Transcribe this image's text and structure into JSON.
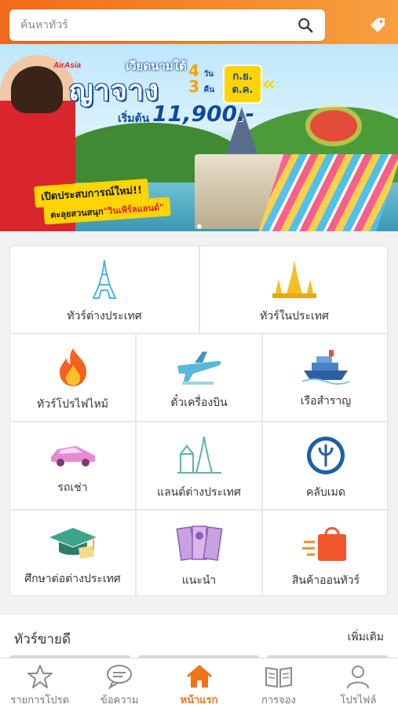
{
  "search": {
    "placeholder": "ค้นหาทัวร์",
    "icon": "search-icon"
  },
  "header": {
    "promo_icon": "tag-icon",
    "brand_color": "#f26a1b"
  },
  "banner": {
    "brand": "AirAsia",
    "subtitle": "เวียดนามใต้",
    "title": "ญาจาง",
    "days": "4",
    "days_unit": "วัน",
    "nights": "3",
    "nights_unit": "คืน",
    "period_line1": "ก.ย.",
    "period_line2": "ต.ค.",
    "price_label": "เริ่มต้น",
    "price": "11,900.-",
    "promo_line1": "เปิดประสบการณ์ใหม่!!",
    "promo_line2_prefix": "ตะลุยสวนสนุก",
    "promo_line2_highlight": "\"วินเพิร์ลแลนด์\""
  },
  "menu": [
    {
      "label": "ทัวร์ต่างประเทศ",
      "icon": "eiffel-tower-icon"
    },
    {
      "label": "ทัวร์ในประเทศ",
      "icon": "thai-temple-icon"
    },
    {
      "label": "ทัวร์โปรไฟไหม้",
      "icon": "fire-icon"
    },
    {
      "label": "ตั๋วเครื่องบิน",
      "icon": "airplane-icon"
    },
    {
      "label": "เรือสำราญ",
      "icon": "cruise-ship-icon"
    },
    {
      "label": "รถเช่า",
      "icon": "car-icon"
    },
    {
      "label": "แลนด์ต่างประเทศ",
      "icon": "landmarks-icon"
    },
    {
      "label": "คลับเมด",
      "icon": "trident-icon"
    },
    {
      "label": "ศึกษาต่อต่างประเทศ",
      "icon": "graduation-cap-icon"
    },
    {
      "label": "แนะนำ",
      "icon": "recommend-cards-icon"
    },
    {
      "label": "สินค้าออนทัวร์",
      "icon": "shopping-bag-icon"
    }
  ],
  "best_sellers": {
    "title": "ทัวร์ขายดี",
    "more": "เพิ่มเติม"
  },
  "bottom_nav": [
    {
      "label": "รายการโปรด",
      "icon": "star-icon",
      "active": false
    },
    {
      "label": "ข้อความ",
      "icon": "chat-icon",
      "active": false
    },
    {
      "label": "หน้าแรก",
      "icon": "home-icon",
      "active": true
    },
    {
      "label": "การจอง",
      "icon": "book-icon",
      "active": false
    },
    {
      "label": "โปรไฟล์",
      "icon": "profile-icon",
      "active": false
    }
  ],
  "colors": {
    "accent": "#f0731b",
    "inactive": "#777777"
  }
}
